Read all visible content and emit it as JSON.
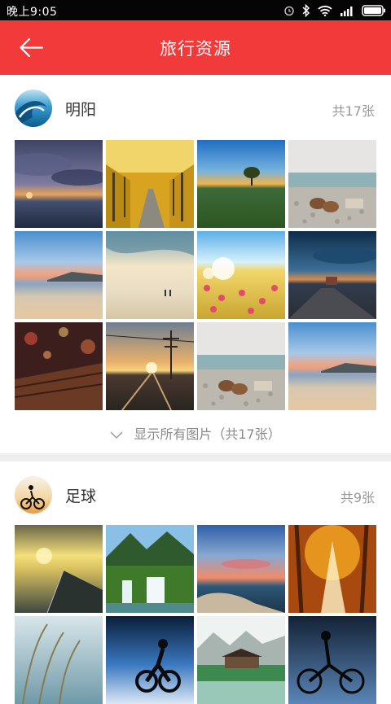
{
  "status_bar": {
    "time": "晚上9:05",
    "icons": [
      "alarm-icon",
      "bluetooth-icon",
      "wifi-icon",
      "signal-icon",
      "battery-icon"
    ]
  },
  "app_bar": {
    "title": "旅行资源",
    "back_icon": "back-arrow-icon",
    "background_color": "#f23a3a"
  },
  "albums": [
    {
      "name": "明阳",
      "count_label": "共17张",
      "avatar": "ocean-wave",
      "show_all_label": "显示所有图片（共17张）",
      "photos": [
        "stormy-sunset-beach",
        "golden-ginkgo-road",
        "lone-tree-sunset",
        "shoes-on-pebbles",
        "beach-mountain-dusk",
        "people-on-beach",
        "dandelion-field",
        "road-twilight-sky",
        "bokeh-wooden-bench",
        "railway-sunset",
        "shoes-on-pebbles",
        "beach-mountain-dusk"
      ]
    },
    {
      "name": "足球",
      "count_label": "共9张",
      "avatar": "cyclist-silhouette",
      "photos": [
        "sunset-bridge",
        "mountain-waterfall",
        "coast-rocks-sunset",
        "forest-light-rays",
        "reeds-sky",
        "cyclist-jump",
        "lake-pavilion",
        "cyclist-silhouette-dark"
      ]
    }
  ]
}
